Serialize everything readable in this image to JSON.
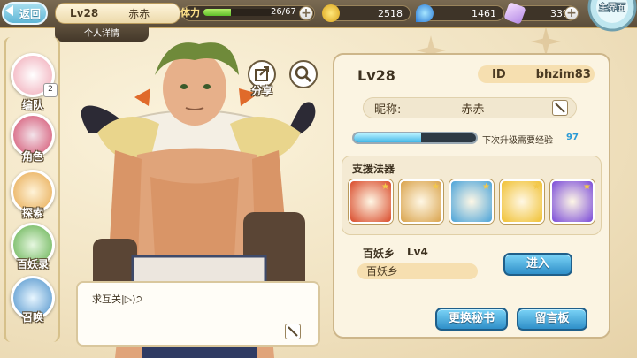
{
  "header": {
    "back_label": "返回",
    "level": "Lv28",
    "player_name": "赤赤",
    "info_tab": "个人详情",
    "stamina_label": "体力",
    "stamina_value": "26/67",
    "stamina_ratio": 0.39,
    "coins": "2518",
    "gems": "1461",
    "crystals": "339",
    "home_label": "主界面"
  },
  "menu": {
    "items": [
      {
        "label": "编队",
        "badge": "2"
      },
      {
        "label": "角色"
      },
      {
        "label": "探索"
      },
      {
        "label": "百妖录"
      },
      {
        "label": "召唤"
      }
    ]
  },
  "actions": {
    "share_label": "分享"
  },
  "profile": {
    "level": "Lv28",
    "id_label": "ID",
    "id_value": "bhzim83",
    "nickname_label": "昵称:",
    "nickname_value": "赤赤",
    "exp_label": "下次升级需要经验",
    "exp_value": "97",
    "exp_ratio": 0.55
  },
  "support": {
    "title": "支援法器",
    "weapons": [
      {
        "icon": "fire-fan-weapon-icon",
        "color": "#d94a2a"
      },
      {
        "icon": "dark-bow-weapon-icon",
        "color": "#d9a24a"
      },
      {
        "icon": "water-ring-weapon-icon",
        "color": "#4aa3d9"
      },
      {
        "icon": "golden-blade-weapon-icon",
        "color": "#f0c030"
      },
      {
        "icon": "star-sword-weapon-icon",
        "color": "#7a4ad9"
      }
    ]
  },
  "yaoxiang": {
    "title": "百妖乡",
    "level": "Lv4",
    "name": "百妖乡",
    "enter_label": "进入"
  },
  "buttons": {
    "change_secretary": "更换秘书",
    "message_board": "留言板"
  },
  "dialogue": {
    "text": "求互关|▷)੭"
  }
}
